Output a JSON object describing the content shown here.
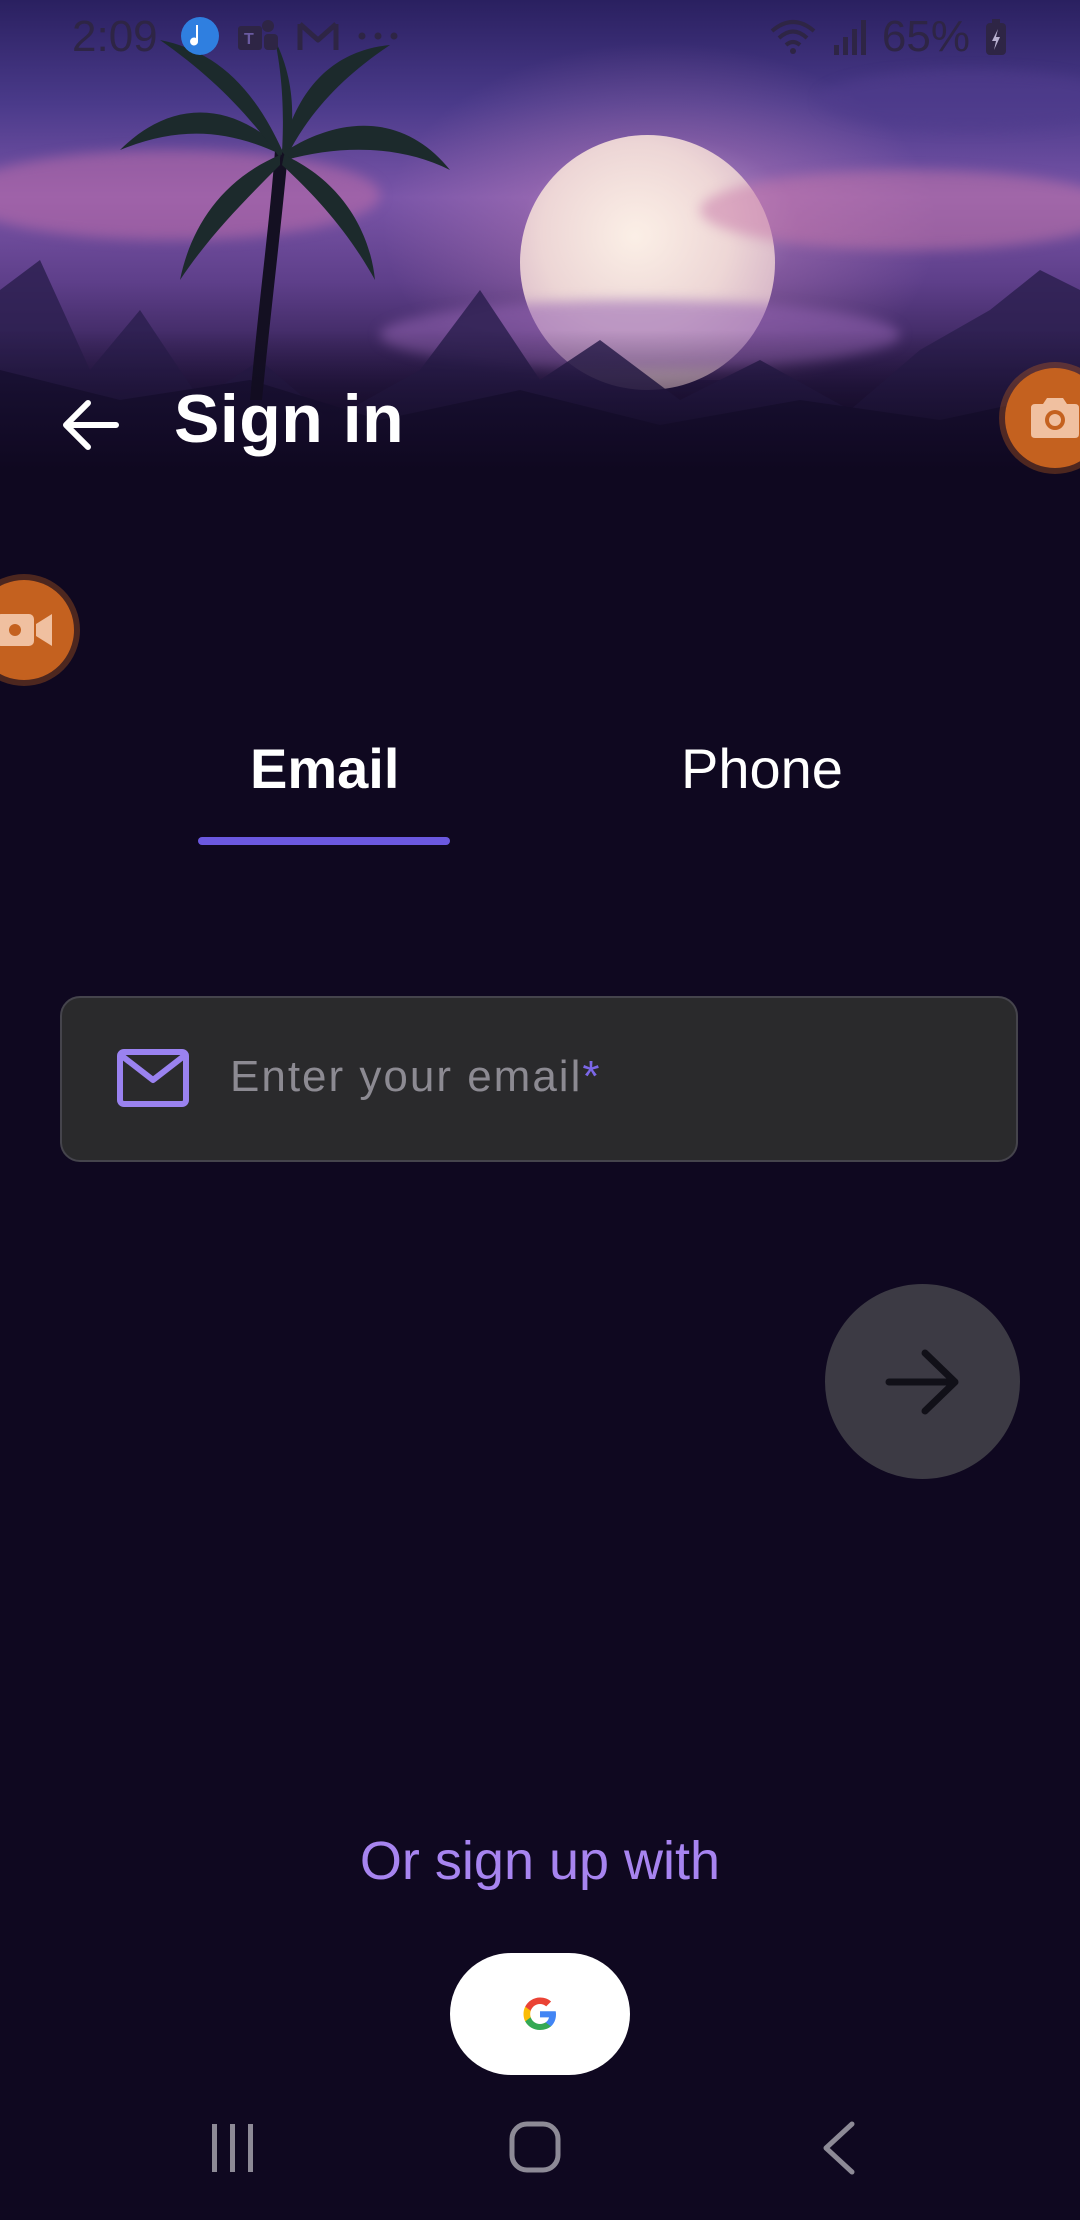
{
  "status_bar": {
    "time": "2:09",
    "battery": "65%",
    "left_icons": [
      "soundlive-app-icon",
      "teams-icon",
      "gmail-icon",
      "more-dots-icon"
    ],
    "right_icons": [
      "wifi-icon",
      "signal-icon",
      "battery-icon"
    ]
  },
  "header": {
    "title": "Sign in",
    "back_icon": "arrow-left-icon"
  },
  "tabs": [
    {
      "label": "Email",
      "selected": true
    },
    {
      "label": "Phone",
      "selected": false
    }
  ],
  "email_input": {
    "placeholder": "Enter your email",
    "required_mark": "*",
    "icon": "mail-icon"
  },
  "next_button": {
    "icon": "arrow-right-icon"
  },
  "social": {
    "label": "Or sign up with",
    "providers": [
      {
        "name": "google",
        "icon": "google-g-icon"
      }
    ]
  },
  "floating": {
    "camera_icon": "camera-icon",
    "video_icon": "video-camera-icon"
  },
  "nav_bar": {
    "items": [
      "recents-icon",
      "home-icon",
      "back-chevron-icon"
    ]
  },
  "colors": {
    "background": "#0f0820",
    "accent": "#6b58e0",
    "accent_text": "#a784f0",
    "field_bg": "#2a2a2c",
    "next_button_bg": "#3c3a44",
    "recorder_orange": "#c4611f"
  }
}
